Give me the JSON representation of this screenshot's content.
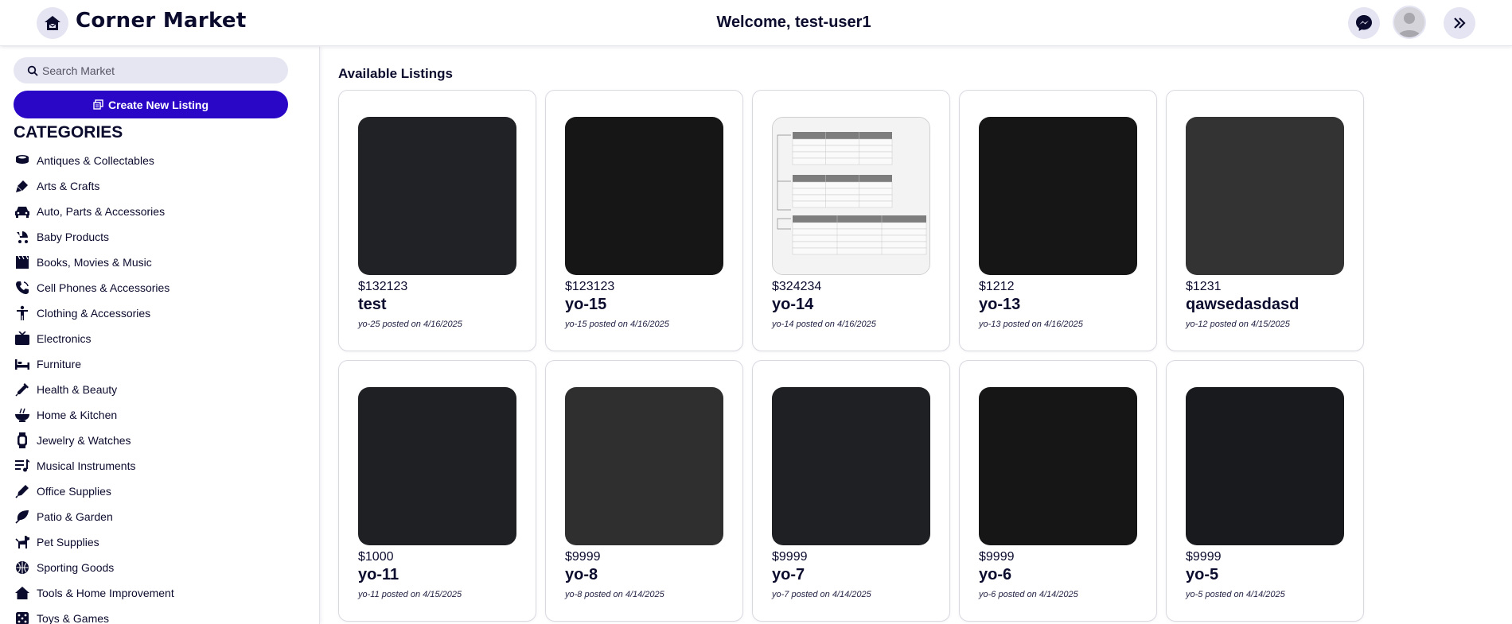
{
  "header": {
    "app_name": "Corner Market",
    "welcome": "Welcome, test-user1",
    "icons": {
      "logo": "home-mail-icon",
      "messenger": "messenger-icon",
      "avatar": "user-avatar-icon",
      "expand": "double-chevron-right-icon"
    }
  },
  "sidebar": {
    "search_placeholder": "Search Market",
    "create_label": "Create New Listing",
    "categories_title": "CATEGORIES",
    "categories": [
      {
        "label": "Antiques & Collectables",
        "icon": "antique-icon"
      },
      {
        "label": "Arts & Crafts",
        "icon": "paint-brush-icon"
      },
      {
        "label": "Auto, Parts & Accessories",
        "icon": "car-icon"
      },
      {
        "label": "Baby Products",
        "icon": "stroller-icon"
      },
      {
        "label": "Books, Movies & Music",
        "icon": "clapperboard-icon"
      },
      {
        "label": "Cell Phones & Accessories",
        "icon": "phone-icon"
      },
      {
        "label": "Clothing & Accessories",
        "icon": "person-icon"
      },
      {
        "label": "Electronics",
        "icon": "tv-icon"
      },
      {
        "label": "Furniture",
        "icon": "bed-icon"
      },
      {
        "label": "Health & Beauty",
        "icon": "syringe-icon"
      },
      {
        "label": "Home & Kitchen",
        "icon": "bowl-icon"
      },
      {
        "label": "Jewelry & Watches",
        "icon": "watch-icon"
      },
      {
        "label": "Musical Instruments",
        "icon": "music-list-icon"
      },
      {
        "label": "Office Supplies",
        "icon": "pen-icon"
      },
      {
        "label": "Patio & Garden",
        "icon": "leaf-icon"
      },
      {
        "label": "Pet Supplies",
        "icon": "dog-icon"
      },
      {
        "label": "Sporting Goods",
        "icon": "basketball-icon"
      },
      {
        "label": "Tools & Home Improvement",
        "icon": "house-icon"
      },
      {
        "label": "Toys & Games",
        "icon": "dice-icon"
      }
    ]
  },
  "main": {
    "title": "Available Listings",
    "listings": [
      {
        "price": "$132123",
        "name": "test",
        "meta": "yo-25 posted on 4/16/2025",
        "img_color": "#212226"
      },
      {
        "price": "$123123",
        "name": "yo-15",
        "meta": "yo-15 posted on 4/16/2025",
        "img_color": "#161616"
      },
      {
        "price": "$324234",
        "name": "yo-14",
        "meta": "yo-14 posted on 4/16/2025",
        "img_color": "screenshot"
      },
      {
        "price": "$1212",
        "name": "yo-13",
        "meta": "yo-13 posted on 4/16/2025",
        "img_color": "#161616"
      },
      {
        "price": "$1231",
        "name": "qawsedasdasd",
        "meta": "yo-12 posted on 4/15/2025",
        "img_color": "#333333"
      },
      {
        "price": "$1000",
        "name": "yo-11",
        "meta": "yo-11 posted on 4/15/2025",
        "img_color": "#1f2023"
      },
      {
        "price": "$9999",
        "name": "yo-8",
        "meta": "yo-8 posted on 4/14/2025",
        "img_color": "#2f2f2f"
      },
      {
        "price": "$9999",
        "name": "yo-7",
        "meta": "yo-7 posted on 4/14/2025",
        "img_color": "#1f2023"
      },
      {
        "price": "$9999",
        "name": "yo-6",
        "meta": "yo-6 posted on 4/14/2025",
        "img_color": "#161616"
      },
      {
        "price": "$9999",
        "name": "yo-5",
        "meta": "yo-5 posted on 4/14/2025",
        "img_color": "#181a1d"
      }
    ]
  },
  "colors": {
    "accent": "#2a07c6",
    "text": "#0b0b2e",
    "pill": "#e4e4f2"
  }
}
